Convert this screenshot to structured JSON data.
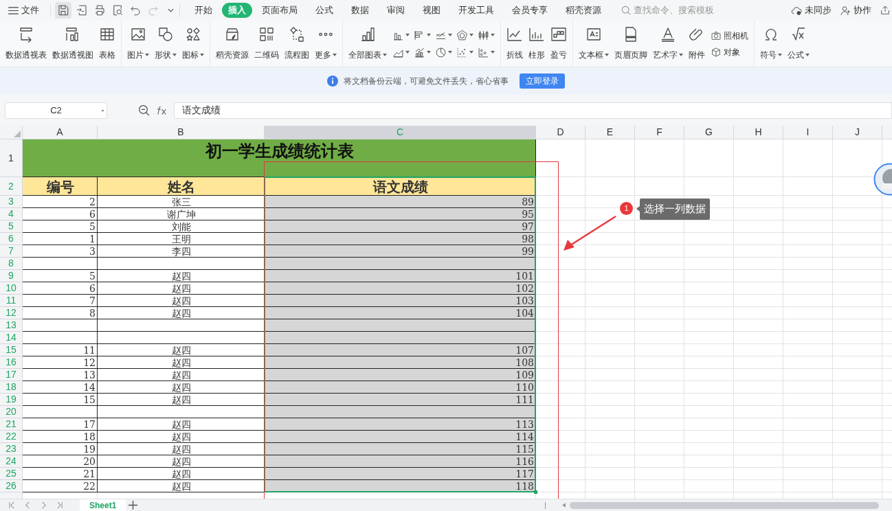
{
  "menu": {
    "label": "文件"
  },
  "tabs": [
    {
      "label": "开始",
      "selected": false
    },
    {
      "label": "插入",
      "selected": true
    },
    {
      "label": "页面布局",
      "selected": false
    },
    {
      "label": "公式",
      "selected": false
    },
    {
      "label": "数据",
      "selected": false
    },
    {
      "label": "审阅",
      "selected": false
    },
    {
      "label": "视图",
      "selected": false
    },
    {
      "label": "开发工具",
      "selected": false
    },
    {
      "label": "会员专享",
      "selected": false
    },
    {
      "label": "稻壳资源",
      "selected": false
    }
  ],
  "search": {
    "placeholder": "查找命令、搜索模板"
  },
  "top_actions": [
    "未同步",
    "协作"
  ],
  "ribbon": [
    [
      {
        "kind": "large",
        "label": "数据透视表",
        "dropdown": false
      },
      {
        "kind": "large",
        "label": "数据透视图",
        "dropdown": false
      },
      {
        "kind": "large",
        "label": "表格",
        "dropdown": false
      }
    ],
    [
      {
        "kind": "large",
        "label": "图片",
        "dropdown": true
      },
      {
        "kind": "large",
        "label": "形状",
        "dropdown": true
      },
      {
        "kind": "large",
        "label": "图标",
        "dropdown": true
      }
    ],
    [
      {
        "kind": "large",
        "label": "稻壳资源",
        "dropdown": false
      },
      {
        "kind": "large",
        "label": "二维码",
        "dropdown": false
      },
      {
        "kind": "large",
        "label": "流程图",
        "dropdown": false
      },
      {
        "kind": "large",
        "label": "更多",
        "dropdown": true
      }
    ],
    [
      {
        "kind": "large",
        "label": "全部图表",
        "dropdown": true
      },
      {
        "kind": "charts"
      }
    ],
    [
      {
        "kind": "large",
        "label": "折线",
        "dropdown": false
      },
      {
        "kind": "large",
        "label": "柱形",
        "dropdown": false
      },
      {
        "kind": "large",
        "label": "盈亏",
        "dropdown": false
      }
    ],
    [
      {
        "kind": "large",
        "label": "文本框",
        "dropdown": true
      },
      {
        "kind": "large",
        "label": "页眉页脚",
        "dropdown": false
      },
      {
        "kind": "large",
        "label": "艺术字",
        "dropdown": true
      },
      {
        "kind": "large",
        "label": "附件",
        "dropdown": false
      },
      {
        "kind": "small",
        "label": "照相机",
        "dropdown": false
      },
      {
        "kind": "small",
        "label": "对象",
        "dropdown": false
      }
    ],
    [
      {
        "kind": "large",
        "label": "符号",
        "dropdown": true
      },
      {
        "kind": "large",
        "label": "公式",
        "dropdown": true
      }
    ]
  ],
  "notice": {
    "text": "将文档备份云端，可避免文件丢失，省心省事",
    "button": "立即登录"
  },
  "name_box": "C2",
  "formula": "语文成绩",
  "columns": [
    {
      "label": "A",
      "selected": false
    },
    {
      "label": "B",
      "selected": false
    },
    {
      "label": "C",
      "selected": true
    },
    {
      "label": "D",
      "selected": false
    },
    {
      "label": "E",
      "selected": false
    },
    {
      "label": "F",
      "selected": false
    },
    {
      "label": "G",
      "selected": false
    },
    {
      "label": "H",
      "selected": false
    },
    {
      "label": "I",
      "selected": false
    },
    {
      "label": "J",
      "selected": false
    }
  ],
  "rows": [
    {
      "row": "1",
      "kind": "title",
      "selected": false,
      "cells": [
        "初一学生成绩统计表"
      ]
    },
    {
      "row": "2",
      "kind": "header",
      "selected": true,
      "cells": [
        "编号",
        "姓名",
        "语文成绩"
      ]
    },
    {
      "row": "3",
      "kind": "data",
      "selected": true,
      "cells": [
        "2",
        "张三",
        "89"
      ]
    },
    {
      "row": "4",
      "kind": "data",
      "selected": true,
      "cells": [
        "6",
        "谢广坤",
        "95"
      ]
    },
    {
      "row": "5",
      "kind": "data",
      "selected": true,
      "cells": [
        "5",
        "刘能",
        "97"
      ]
    },
    {
      "row": "6",
      "kind": "data",
      "selected": true,
      "cells": [
        "1",
        "王明",
        "98"
      ]
    },
    {
      "row": "7",
      "kind": "data",
      "selected": true,
      "cells": [
        "3",
        "李四",
        "99"
      ]
    },
    {
      "row": "8",
      "kind": "data",
      "selected": true,
      "cells": []
    },
    {
      "row": "9",
      "kind": "data",
      "selected": true,
      "cells": [
        "5",
        "赵四",
        "101"
      ]
    },
    {
      "row": "10",
      "kind": "data",
      "selected": true,
      "cells": [
        "6",
        "赵四",
        "102"
      ]
    },
    {
      "row": "11",
      "kind": "data",
      "selected": true,
      "cells": [
        "7",
        "赵四",
        "103"
      ]
    },
    {
      "row": "12",
      "kind": "data",
      "selected": true,
      "cells": [
        "8",
        "赵四",
        "104"
      ]
    },
    {
      "row": "13",
      "kind": "data",
      "selected": true,
      "cells": []
    },
    {
      "row": "14",
      "kind": "data",
      "selected": true,
      "cells": []
    },
    {
      "row": "15",
      "kind": "data",
      "selected": true,
      "cells": [
        "11",
        "赵四",
        "107"
      ]
    },
    {
      "row": "16",
      "kind": "data",
      "selected": true,
      "cells": [
        "12",
        "赵四",
        "108"
      ]
    },
    {
      "row": "17",
      "kind": "data",
      "selected": true,
      "cells": [
        "13",
        "赵四",
        "109"
      ]
    },
    {
      "row": "18",
      "kind": "data",
      "selected": true,
      "cells": [
        "14",
        "赵四",
        "110"
      ]
    },
    {
      "row": "19",
      "kind": "data",
      "selected": true,
      "cells": [
        "15",
        "赵四",
        "111"
      ]
    },
    {
      "row": "20",
      "kind": "data",
      "selected": true,
      "cells": []
    },
    {
      "row": "21",
      "kind": "data",
      "selected": true,
      "cells": [
        "17",
        "赵四",
        "113"
      ]
    },
    {
      "row": "22",
      "kind": "data",
      "selected": true,
      "cells": [
        "18",
        "赵四",
        "114"
      ]
    },
    {
      "row": "23",
      "kind": "data",
      "selected": true,
      "cells": [
        "19",
        "赵四",
        "115"
      ]
    },
    {
      "row": "24",
      "kind": "data",
      "selected": true,
      "cells": [
        "20",
        "赵四",
        "116"
      ]
    },
    {
      "row": "25",
      "kind": "data",
      "selected": true,
      "cells": [
        "21",
        "赵四",
        "117"
      ]
    },
    {
      "row": "26",
      "kind": "data",
      "selected": true,
      "cells": [
        "22",
        "赵四",
        "118"
      ]
    }
  ],
  "annotation": {
    "badge": "1",
    "text": "选择一列数据"
  },
  "sheet_tabs": [
    {
      "label": "Sheet1",
      "selected": true
    }
  ]
}
